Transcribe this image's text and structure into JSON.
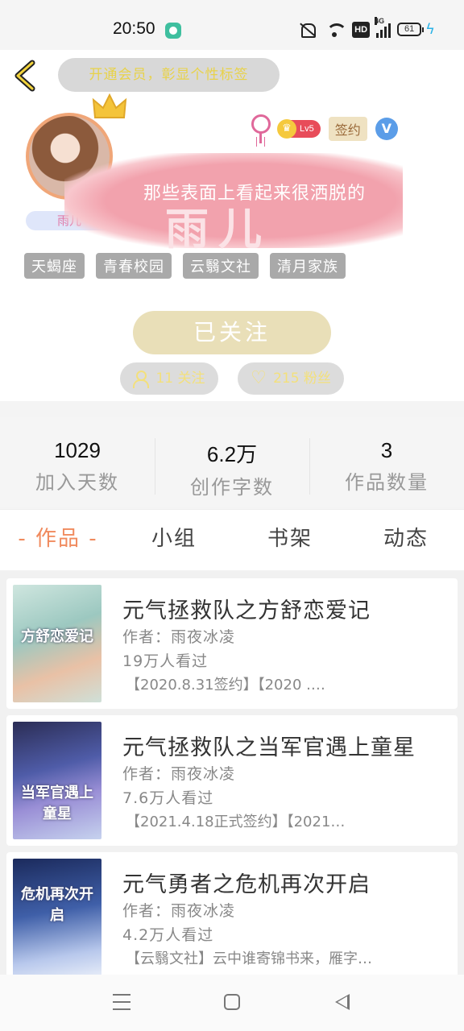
{
  "status_bar": {
    "time": "20:50",
    "hd_label": "HD",
    "network": "4G",
    "battery": "61"
  },
  "header": {
    "motto": "开通会员，彰显个性标签"
  },
  "profile": {
    "nickname": "雨儿",
    "level": "Lv5",
    "signed_label": "签约",
    "verify_label": "V",
    "avatar_badge": "V",
    "signature_text": "那些表面上看起来很洒脱的",
    "signature_name": "雨儿",
    "tags": [
      "天蝎座",
      "青春校园",
      "云翳文社",
      "清月家族"
    ],
    "follow_label": "已关注",
    "following_label": "11 关注",
    "fans_label": "215 粉丝"
  },
  "stats": [
    {
      "value": "1029",
      "label": "加入天数"
    },
    {
      "value": "6.2万",
      "label": "创作字数"
    },
    {
      "value": "3",
      "label": "作品数量"
    }
  ],
  "tabs": [
    "- 作品 -",
    "小组",
    "书架",
    "动态"
  ],
  "books": [
    {
      "cover_text": "方舒恋爱记",
      "title": "元气拯救队之方舒恋爱记",
      "author": "作者：雨夜冰凌",
      "views": "19万人看过",
      "note": "【2020.8.31签约】【2020 .…"
    },
    {
      "cover_text": "当军官遇上童星",
      "title": "元气拯救队之当军官遇上童星",
      "author": "作者：雨夜冰凌",
      "views": "7.6万人看过",
      "note": "【2021.4.18正式签约】【2021…"
    },
    {
      "cover_text": "危机再次开启",
      "title": "元气勇者之危机再次开启",
      "author": "作者：雨夜冰凌",
      "views": "4.2万人看过",
      "note": "【云翳文社】云中谁寄锦书来，雁字…"
    }
  ],
  "colors": {
    "accent": "#f08a5d",
    "follow_button": "#e9dfb8",
    "tag_bg": "#a9a9a9",
    "signature_bg": "#f2a2ad"
  }
}
